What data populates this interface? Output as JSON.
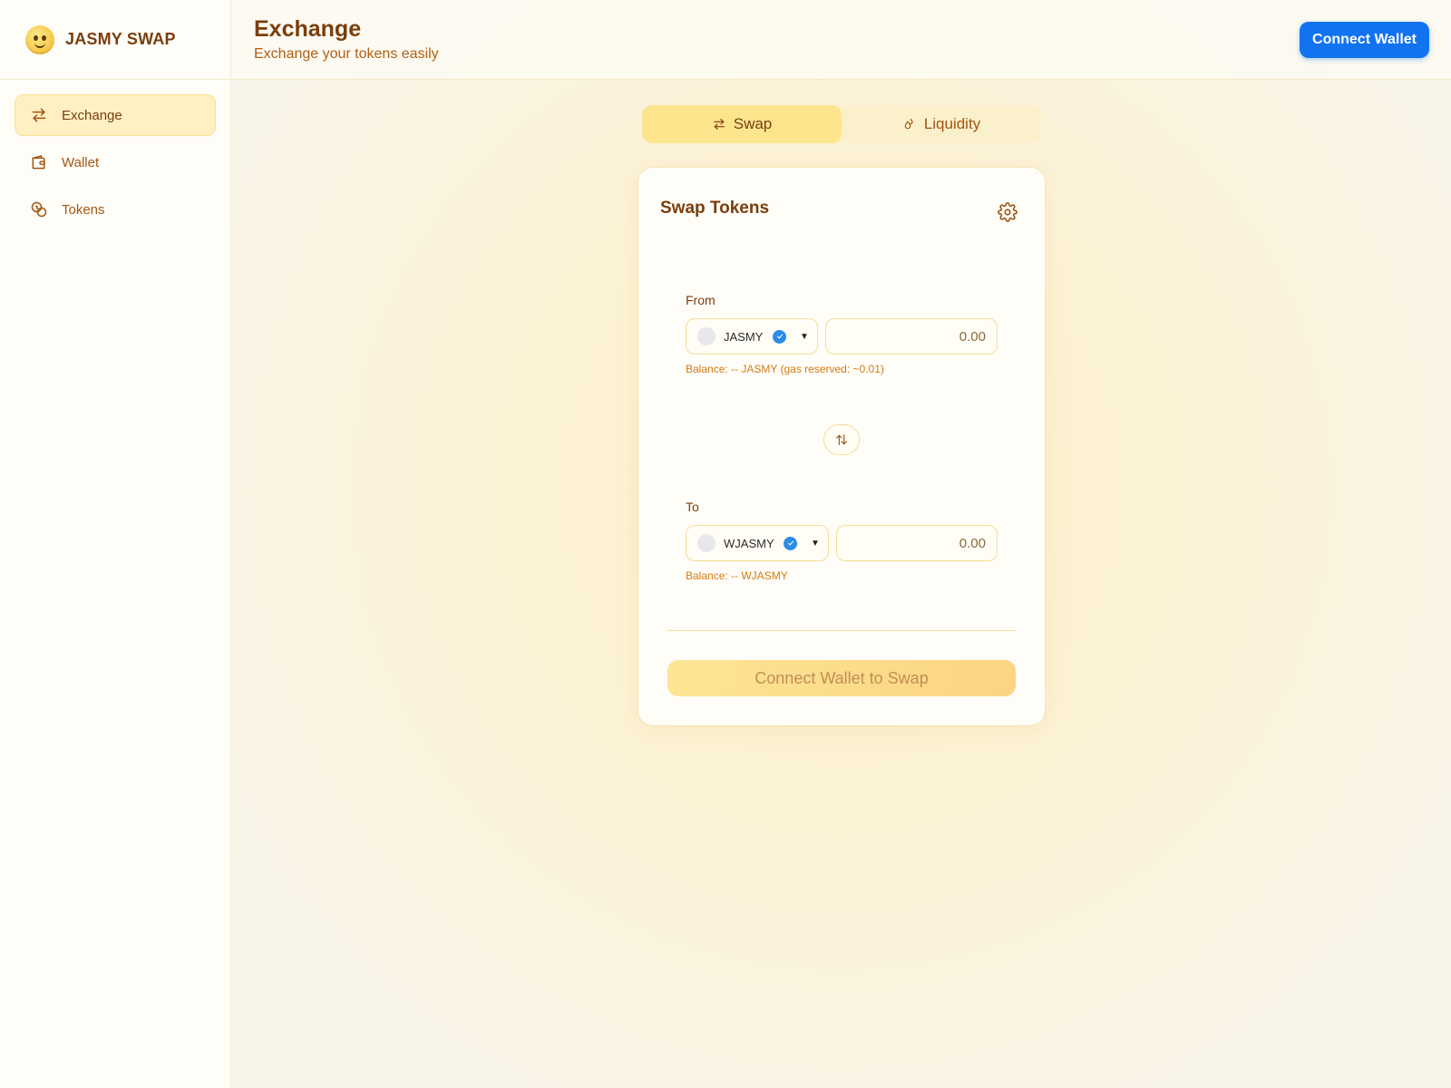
{
  "app": {
    "name": "JASMY SWAP"
  },
  "sidebar": {
    "items": [
      {
        "label": "Exchange",
        "icon": "arrows-exchange-icon",
        "active": true
      },
      {
        "label": "Wallet",
        "icon": "wallet-icon",
        "active": false
      },
      {
        "label": "Tokens",
        "icon": "coins-icon",
        "active": false
      }
    ]
  },
  "header": {
    "title": "Exchange",
    "subtitle": "Exchange your tokens easily",
    "connect_label": "Connect Wallet"
  },
  "tabs": [
    {
      "label": "Swap",
      "icon": "swap-arrows-icon",
      "active": true
    },
    {
      "label": "Liquidity",
      "icon": "droplets-icon",
      "active": false
    }
  ],
  "card": {
    "title": "Swap Tokens",
    "from": {
      "label": "From",
      "token": "JASMY",
      "amount_placeholder": "0.00",
      "balance": "Balance: -- JASMY (gas reserved: ~0.01)"
    },
    "to": {
      "label": "To",
      "token": "WJASMY",
      "amount_placeholder": "0.00",
      "balance": "Balance: -- WJASMY"
    },
    "action_label": "Connect Wallet to Swap"
  },
  "colors": {
    "accent": "#1273f0",
    "brand_brown": "#7a3e0c",
    "muted_orange": "#a35612",
    "verified_blue": "#2a8de8"
  }
}
